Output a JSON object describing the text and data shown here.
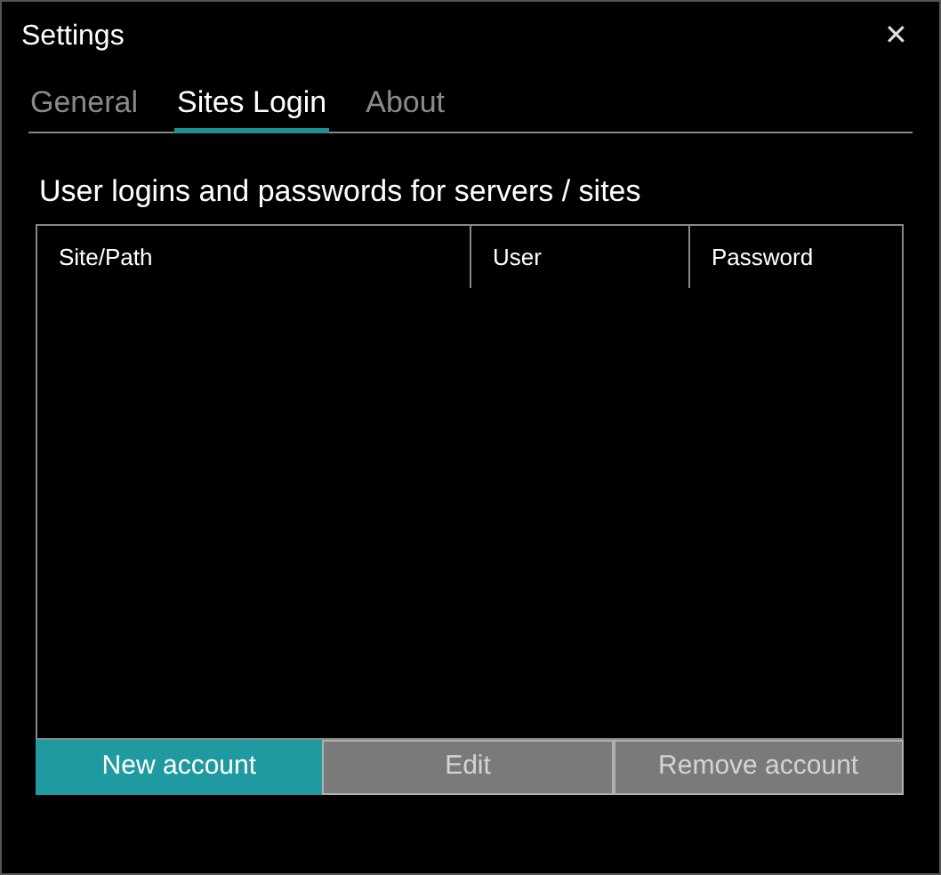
{
  "window": {
    "title": "Settings",
    "close": "✕"
  },
  "tabs": [
    {
      "label": "General",
      "selected": false
    },
    {
      "label": "Sites Login",
      "selected": true
    },
    {
      "label": "About",
      "selected": false
    }
  ],
  "heading": "User logins and passwords for servers / sites",
  "table": {
    "columns": [
      "Site/Path",
      "User",
      "Password"
    ]
  },
  "buttons": [
    {
      "label": "New account",
      "disabled": false
    },
    {
      "label": "Edit",
      "disabled": true
    },
    {
      "label": "Remove account",
      "disabled": true
    }
  ]
}
